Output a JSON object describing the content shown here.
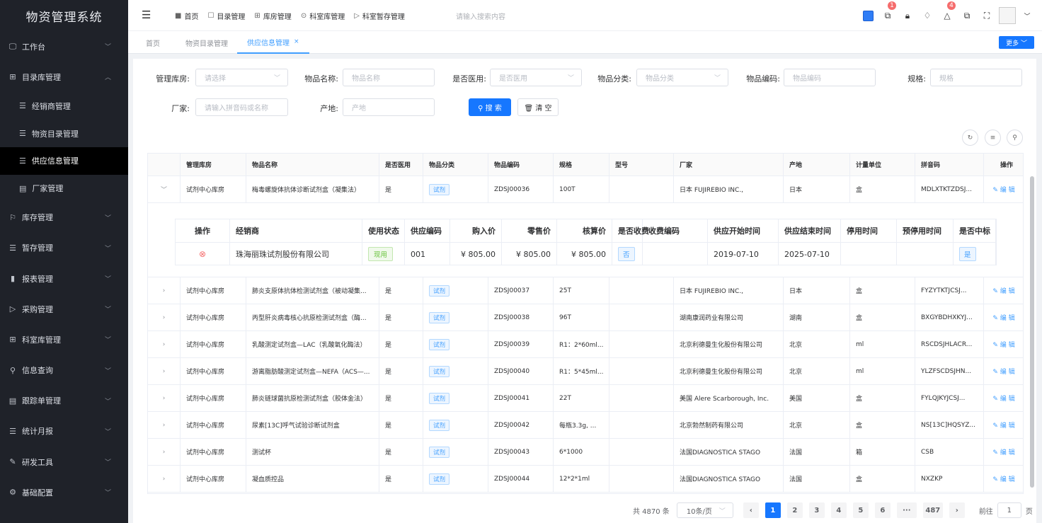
{
  "app": {
    "title": "物资管理系统"
  },
  "sidebar": {
    "items": [
      {
        "icon": "🖵",
        "label": "工作台",
        "expand": "﹀"
      },
      {
        "icon": "⊞",
        "label": "目录库管理",
        "expand": "︿"
      },
      {
        "icon": "☰",
        "label": "经销商管理",
        "sub": true
      },
      {
        "icon": "☰",
        "label": "物资目录管理",
        "sub": true
      },
      {
        "icon": "☰",
        "label": "供应信息管理",
        "sub": true,
        "active": true
      },
      {
        "icon": "▤",
        "label": "厂家管理",
        "sub": true
      },
      {
        "icon": "⚐",
        "label": "库存管理",
        "expand": "﹀"
      },
      {
        "icon": "☰",
        "label": "暂存管理",
        "expand": "﹀"
      },
      {
        "icon": "▮",
        "label": "报表管理",
        "expand": "﹀"
      },
      {
        "icon": "▷",
        "label": "采购管理",
        "expand": "﹀"
      },
      {
        "icon": "⊞",
        "label": "科室库管理",
        "expand": "﹀"
      },
      {
        "icon": "⚲",
        "label": "信息查询",
        "expand": "﹀"
      },
      {
        "icon": "▤",
        "label": "跟踪单管理",
        "expand": "﹀"
      },
      {
        "icon": "☰",
        "label": "统计月报",
        "expand": "﹀"
      },
      {
        "icon": "✎",
        "label": "研发工具",
        "expand": "﹀"
      },
      {
        "icon": "⚙",
        "label": "基础配置",
        "expand": "﹀"
      }
    ]
  },
  "topbar": {
    "nav": [
      {
        "icon": "■",
        "label": "首页"
      },
      {
        "icon": "☐",
        "label": "目录管理"
      },
      {
        "icon": "⊞",
        "label": "库房管理"
      },
      {
        "icon": "⊙",
        "label": "科室库管理"
      },
      {
        "icon": "▷",
        "label": "科室暂存管理"
      }
    ],
    "search_placeholder": "请输入搜索内容",
    "badges": {
      "notify1": "1",
      "notify2": "4"
    }
  },
  "tabs": [
    {
      "label": "首页"
    },
    {
      "label": "物资目录管理"
    },
    {
      "label": "供应信息管理",
      "close": "×"
    }
  ],
  "more_button": "更多 ﹀",
  "filters": {
    "warehouse": {
      "label": "管理库房:",
      "placeholder": "请选择"
    },
    "name": {
      "label": "物品名称:",
      "placeholder": "物品名称"
    },
    "medical": {
      "label": "是否医用:",
      "placeholder": "是否医用"
    },
    "category": {
      "label": "物品分类:",
      "placeholder": "物品分类"
    },
    "code": {
      "label": "物品编码:",
      "placeholder": "物品编码"
    },
    "spec": {
      "label": "规格:",
      "placeholder": "规格"
    },
    "maker": {
      "label": "厂家:",
      "placeholder": "请输入拼音码或名称"
    },
    "origin": {
      "label": "产地:",
      "placeholder": "产地"
    },
    "search_button": "⚲ 搜 索",
    "clear_button": "🗑 清 空"
  },
  "table": {
    "columns": [
      "管理库房",
      "物品名称",
      "是否医用",
      "物品分类",
      "物品编码",
      "规格",
      "型号",
      "厂家",
      "产地",
      "计量单位",
      "拼音码",
      "操作"
    ],
    "edit_label": "✎ 编 辑",
    "rows": [
      {
        "expand": "﹀",
        "warehouse": "试剂中心库房",
        "name": "梅毒螺旋体抗体诊断试剂盒（凝集法）",
        "medical": "是",
        "category": "试剂",
        "code": "ZDSJ00036",
        "spec": "100T",
        "model": "",
        "maker": "日本 FUJIREBIO INC.,",
        "origin": "日本",
        "unit": "盒",
        "pinyin": "MDLXTKTZDSJ..."
      },
      {
        "expand": "›",
        "warehouse": "试剂中心库房",
        "name": "肺炎支原体抗体检测试剂盒（被动凝集...",
        "medical": "是",
        "category": "试剂",
        "code": "ZDSJ00037",
        "spec": "25T",
        "model": "",
        "maker": "日本 FUJIREBIO INC.,",
        "origin": "日本",
        "unit": "盒",
        "pinyin": "FYZYTKTJCSJ..."
      },
      {
        "expand": "›",
        "warehouse": "试剂中心库房",
        "name": "丙型肝炎病毒核心抗原检测试剂盒（酶...",
        "medical": "是",
        "category": "试剂",
        "code": "ZDSJ00038",
        "spec": "96T",
        "model": "",
        "maker": "湖南康润药业有限公司",
        "origin": "湖南",
        "unit": "盒",
        "pinyin": "BXGYBDHXKYJ..."
      },
      {
        "expand": "›",
        "warehouse": "试剂中心库房",
        "name": "乳酸测定试剂盒—LAC（乳酸氧化酶法）",
        "medical": "是",
        "category": "试剂",
        "code": "ZDSJ00039",
        "spec": "R1：2*60ml...",
        "model": "",
        "maker": "北京利德曼生化股份有限公司",
        "origin": "北京",
        "unit": "ml",
        "pinyin": "RSCDSJHLACR..."
      },
      {
        "expand": "›",
        "warehouse": "试剂中心库房",
        "name": "游离脂肪酸测定试剂盒—NEFA（ACS—...",
        "medical": "是",
        "category": "试剂",
        "code": "ZDSJ00040",
        "spec": "R1：5*45ml...",
        "model": "",
        "maker": "北京利德曼生化股份有限公司",
        "origin": "北京",
        "unit": "ml",
        "pinyin": "YLZFSCDSJHN..."
      },
      {
        "expand": "›",
        "warehouse": "试剂中心库房",
        "name": "肺炎链球菌抗原检测试剂盒（胶体金法）",
        "medical": "是",
        "category": "试剂",
        "code": "ZDSJ00041",
        "spec": "22T",
        "model": "",
        "maker": "美国 Alere Scarborough, Inc.",
        "origin": "美国",
        "unit": "盒",
        "pinyin": "FYLQJKYJCSJ..."
      },
      {
        "expand": "›",
        "warehouse": "试剂中心库房",
        "name": "尿素[13C]呼气试验诊断试剂盒",
        "medical": "是",
        "category": "试剂",
        "code": "ZDSJ00042",
        "spec": "每瓶3.3g, ...",
        "model": "",
        "maker": "北京勃然制药有限公司",
        "origin": "北京",
        "unit": "盒",
        "pinyin": "NS[13C]HQSYZ..."
      },
      {
        "expand": "›",
        "warehouse": "试剂中心库房",
        "name": "测试杯",
        "medical": "是",
        "category": "试剂",
        "code": "ZDSJ00043",
        "spec": "6*1000",
        "model": "",
        "maker": "法国DIAGNOSTICA STAGO",
        "origin": "法国",
        "unit": "箱",
        "pinyin": "CSB"
      },
      {
        "expand": "›",
        "warehouse": "试剂中心库房",
        "name": "凝血质控品",
        "medical": "是",
        "category": "试剂",
        "code": "ZDSJ00044",
        "spec": "12*2*1ml",
        "model": "",
        "maker": "法国DIAGNOSTICA STAGO",
        "origin": "法国",
        "unit": "盒",
        "pinyin": "NXZKP"
      }
    ]
  },
  "subtable": {
    "columns": [
      "操作",
      "经销商",
      "使用状态",
      "供应编码",
      "购入价",
      "零售价",
      "核算价",
      "是否收费",
      "收费编码",
      "供应开始时间",
      "供应结束时间",
      "停用时间",
      "预停用时间",
      "是否中标"
    ],
    "row": {
      "action": "⊗",
      "dealer": "珠海丽珠试剂股份有限公司",
      "status": "现用",
      "supply_code": "001",
      "buy_price": "¥ 805.00",
      "retail_price": "¥ 805.00",
      "account_price": "¥ 805.00",
      "charge": "否",
      "charge_code": "",
      "start": "2019-07-10",
      "end": "2025-07-10",
      "stop": "",
      "pre_stop": "",
      "bid": "是"
    }
  },
  "pagination": {
    "total": "共 4870 条",
    "page_size": "10条/页",
    "pages": [
      "1",
      "2",
      "3",
      "4",
      "5",
      "6",
      "···",
      "487"
    ],
    "prev": "‹",
    "next": "›",
    "goto_label": "前往",
    "goto_value": "1",
    "page_suffix": "页"
  }
}
